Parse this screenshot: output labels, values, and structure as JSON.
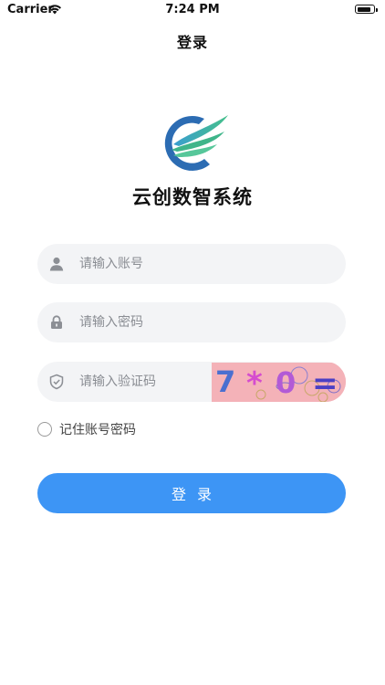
{
  "status_bar": {
    "carrier": "Carrier",
    "time": "7:24 PM",
    "battery_level": 0.85
  },
  "nav": {
    "title": "登录"
  },
  "brand": {
    "app_name": "云创数智系统",
    "logo_icon": "wing-c-logo-icon",
    "colors": {
      "blue": "#2b6fb7",
      "green": "#3cb68c"
    }
  },
  "form": {
    "account": {
      "placeholder": "请输入账号",
      "value": "",
      "icon": "user-icon"
    },
    "password": {
      "placeholder": "请输入密码",
      "value": "",
      "icon": "lock-icon"
    },
    "captcha": {
      "placeholder": "请输入验证码",
      "value": "",
      "icon": "shield-check-icon",
      "image_text": "7*0="
    },
    "remember": {
      "label": "记住账号密码",
      "checked": false
    },
    "login_button": {
      "label": "登录",
      "color": "#3d95f5"
    }
  }
}
